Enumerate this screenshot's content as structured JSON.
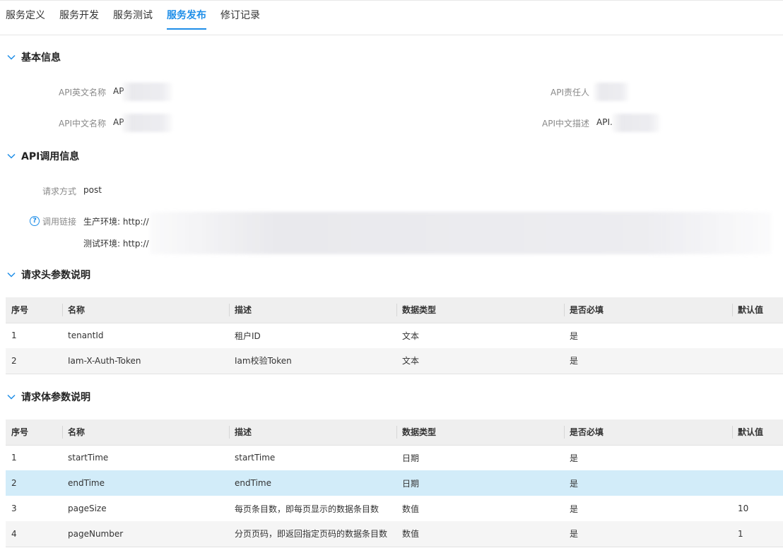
{
  "tabs": [
    {
      "label": "服务定义"
    },
    {
      "label": "服务开发"
    },
    {
      "label": "服务测试"
    },
    {
      "label": "服务发布"
    },
    {
      "label": "修订记录"
    }
  ],
  "sections": {
    "basic": "基本信息",
    "api_call": "API调用信息",
    "req_header": "请求头参数说明",
    "req_body": "请求体参数说明"
  },
  "basic_info": {
    "en_name_label": "API英文名称",
    "en_name_value": "AP",
    "owner_label": "API责任人",
    "cn_name_label": "API中文名称",
    "cn_name_value": "AP",
    "cn_desc_label": "API中文描述",
    "cn_desc_value": "API."
  },
  "api_call": {
    "method_label": "请求方式",
    "method_value": "post",
    "link_label": "调用链接",
    "prod_env": "生产环境: http://",
    "test_env": "测试环境: http://"
  },
  "table_headers": [
    "序号",
    "名称",
    "描述",
    "数据类型",
    "是否必填",
    "默认值"
  ],
  "header_params": [
    [
      "1",
      "tenantId",
      "租户ID",
      "文本",
      "是",
      ""
    ],
    [
      "2",
      "Iam-X-Auth-Token",
      "Iam校验Token",
      "文本",
      "是",
      ""
    ]
  ],
  "body_params": [
    [
      "1",
      "startTime",
      "startTime",
      "日期",
      "是",
      ""
    ],
    [
      "2",
      "endTime",
      "endTime",
      "日期",
      "是",
      ""
    ],
    [
      "3",
      "pageSize",
      "每页条目数，即每页显示的数据条目数",
      "数值",
      "是",
      "10"
    ],
    [
      "4",
      "pageNumber",
      "分页页码，即返回指定页码的数据条目数",
      "数值",
      "是",
      "1"
    ]
  ],
  "colors": {
    "accent": "#1e8ee8",
    "highlight_row": "#d2ecf9"
  },
  "icons": {
    "section_toggle": "chevron-down-icon",
    "help": "help-circle-icon"
  }
}
